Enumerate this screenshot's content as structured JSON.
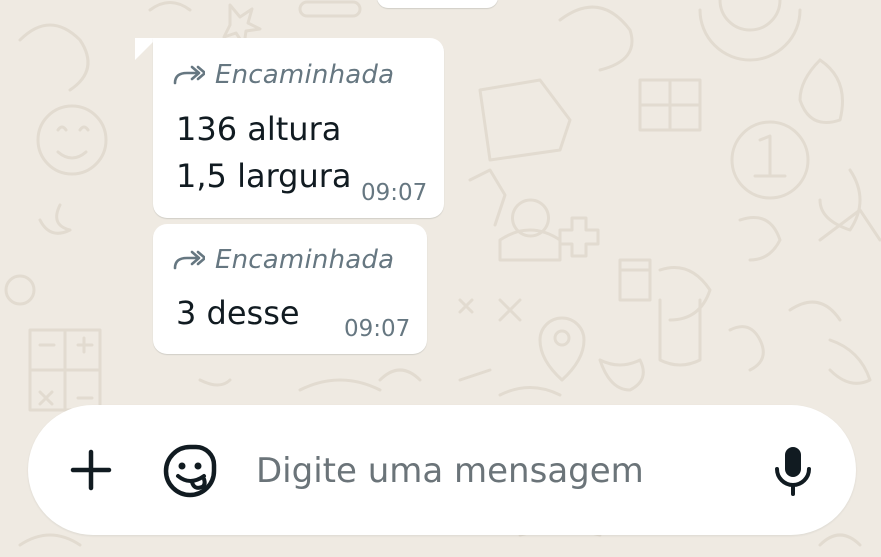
{
  "theme": {
    "chat_background": "#efeae2",
    "bubble_color": "#ffffff",
    "meta_text_color": "#667781",
    "message_text_color": "#111b21"
  },
  "messages": [
    {
      "forwarded_label": "Encaminhada",
      "forward_icon": "forward-arrow-icon",
      "lines": [
        "136 altura",
        "1,5 largura"
      ],
      "time": "09:07"
    },
    {
      "forwarded_label": "Encaminhada",
      "forward_icon": "forward-arrow-icon",
      "lines": [
        "3 desse"
      ],
      "time": "09:07"
    }
  ],
  "composer": {
    "placeholder": "Digite uma mensagem",
    "value": "",
    "attach_icon": "plus-icon",
    "sticker_icon": "sticker-icon",
    "mic_icon": "microphone-icon"
  }
}
